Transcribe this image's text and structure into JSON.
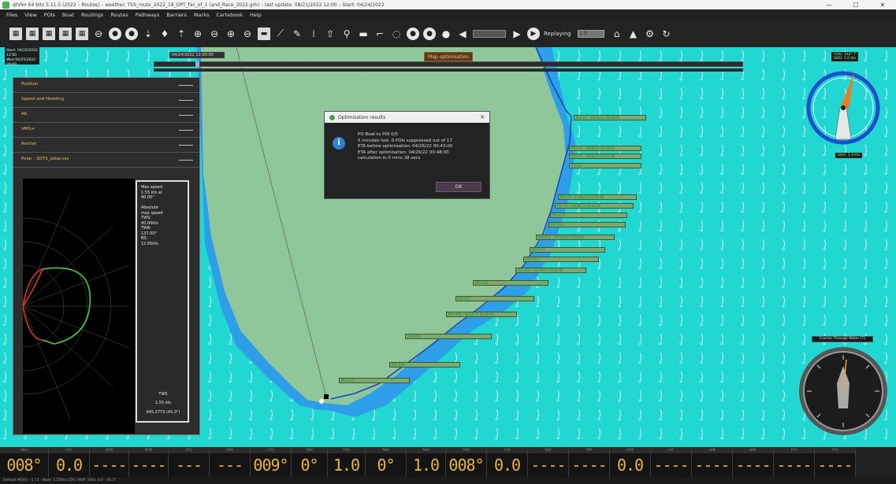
{
  "window": {
    "title": "qtVlm 64 bits 5.11.5 (2022 – Routes) – weather: TSS_route_2022_18_OPT_fac_of_1 (and_Race_2022.grb) – last update: 08/21/2022 12:00 – Start: 04/24/2022",
    "minimize": "—",
    "maximize": "☐",
    "close": "✕"
  },
  "menu": [
    "Files",
    "View",
    "POIs",
    "Boat",
    "Routings",
    "Routes",
    "Pathways",
    "Barriers",
    "Marks",
    "Cartebook",
    "Help"
  ],
  "toolbar": {
    "replay_label": "Replaying",
    "speed_field": "1 h",
    "icons": [
      "save-icon",
      "save-as-icon",
      "open-icon",
      "grib-icon",
      "table-icon",
      "chain-icon",
      "circle-icon",
      "circle-alt-icon",
      "download-icon",
      "pin-icon",
      "pin-alt-icon",
      "zoom-in-icon",
      "zoom-out-icon",
      "zoom-fit-icon",
      "zoom-center-icon",
      "map-icon",
      "measure-icon",
      "pencil-icon",
      "thermometer-icon",
      "anchor-icon",
      "boat-icon",
      "wind-icon",
      "gps-icon",
      "target-icon",
      "sun-icon",
      "moon-icon",
      "dot-icon",
      "prev-icon",
      "next-icon",
      "play-icon"
    ]
  },
  "map": {
    "date_box": [
      "Start: 04/24/2022 12:00",
      "Wed 04/25/2022 09:00"
    ],
    "track_label": "04/24/2022 12:00:00",
    "optimization_badge": "Map optimisation",
    "timeline_fraction": 0.07,
    "waypoints": [
      "POI #4 - 04/26/22 00:46:00",
      "POI #5 - 04/26/22 02:28:00",
      "POI #6 - 04/26/22 04:12:00",
      "POI #7",
      "POI #8 - 04/26/22 07:40:00",
      "POI #9 - 04/26/22 09:24:00",
      "POI #10",
      "POI #11",
      "POI #12 - 04/26/22 12:52:00",
      "POI #13",
      "POI #14",
      "POI #15 - 04/26/22 16:20:00",
      "POI #16",
      "POI #17",
      "POI #18 - 04/26/22 20:36:00",
      "POI #19",
      "POI #20",
      "POI #21"
    ]
  },
  "left_panel": {
    "items": [
      "Position",
      "Speed and Heading",
      "Alt",
      "VMG+",
      "Anchor",
      "Polar : SDTS_polar.csv"
    ],
    "polar_info": [
      "Max speed",
      "1.55 kts at",
      "90.00°",
      "",
      "Absolute",
      "max speed",
      "TWS:",
      "40.00kts",
      "TWA:",
      "137.00°",
      "BS:",
      "12.65kts"
    ],
    "tws_label": "TWS",
    "tws_value": "1.55 kts",
    "twa_value": "045.2773 (45.3°)"
  },
  "dialog": {
    "title": "Optimisation results",
    "lines": [
      "PO Boat to POI 0/5",
      "5 minutes lost, 0 POIs suppressed out of 17",
      "ETA before optimisation: 04/26/22 00:43:00",
      "ETA after optimisation: 04/26/22 00:48:00",
      "calculation in 0 mins 38 secs"
    ],
    "ok": "OK",
    "close": "✕"
  },
  "compass": {
    "top_label_1": "COG: 142° T",
    "top_label_2": "SOG: 1.0 kts",
    "bottom_label": "SOG: 1.4 kts"
  },
  "gauge": {
    "title": "Course Through Water (T)"
  },
  "instruments": [
    {
      "label": "HDG",
      "value": "008°"
    },
    {
      "label": "SOG",
      "value": "0.0"
    },
    {
      "label": "DTW",
      "value": "----"
    },
    {
      "label": "BTW",
      "value": "----"
    },
    {
      "label": "XTE",
      "value": "---"
    },
    {
      "label": "VMG",
      "value": "---"
    },
    {
      "label": "COG",
      "value": "009°"
    },
    {
      "label": "TWA",
      "value": "0°"
    },
    {
      "label": "TWS",
      "value": "1.0"
    },
    {
      "label": "AWA",
      "value": "0°"
    },
    {
      "label": "AWS",
      "value": "1.0"
    },
    {
      "label": "TWD",
      "value": "008°"
    },
    {
      "label": "CUR",
      "value": "0.0"
    },
    {
      "label": "DEP",
      "value": "----"
    },
    {
      "label": "TMP",
      "value": "----"
    },
    {
      "label": "STW",
      "value": "0.0"
    },
    {
      "label": "LAT",
      "value": "----"
    },
    {
      "label": "LON",
      "value": "----"
    },
    {
      "label": "BAR",
      "value": "----"
    },
    {
      "label": "ETA",
      "value": "----"
    },
    {
      "label": "TTG",
      "value": "----"
    }
  ],
  "statusbar": "Default M3(0) - 5 / 5 - Boat: 1.55kts COG: 009° SOG: 0.0 - 45.3°"
}
